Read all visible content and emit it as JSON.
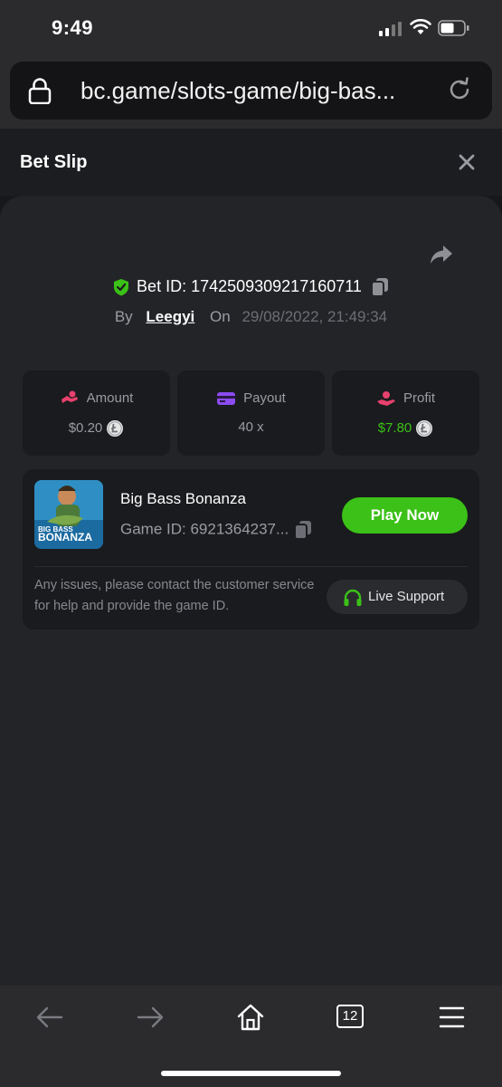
{
  "status_bar": {
    "time": "9:49"
  },
  "browser": {
    "url": "bc.game/slots-game/big-bas...",
    "tab_count": "12"
  },
  "bet_slip": {
    "title": "Bet Slip",
    "bet_id_label": "Bet ID: 1742509309217160711",
    "by_label": "By",
    "username": "Leegyi",
    "on_label": "On",
    "date": "29/08/2022, 21:49:34",
    "stats": [
      {
        "label": "Amount",
        "value": "$0.20",
        "value_color": "#9a9ca2",
        "icon": "amount-icon"
      },
      {
        "label": "Payout",
        "value": "40 x",
        "value_color": "#9a9ca2",
        "icon": "payout-icon"
      },
      {
        "label": "Profit",
        "value": "$7.80",
        "value_color": "#3bc117",
        "icon": "profit-icon"
      }
    ],
    "game": {
      "name": "Big Bass Bonanza",
      "thumb_line1": "BIG BASS",
      "thumb_line2": "BONANZA",
      "game_id": "Game ID: 6921364237...",
      "play_label": "Play Now"
    },
    "issue_text": "Any issues, please contact the customer service for help and provide the game ID.",
    "support_label": "Live Support"
  },
  "colors": {
    "accent_green": "#3bc117",
    "panel": "#232428",
    "card": "#1a1b1e"
  }
}
